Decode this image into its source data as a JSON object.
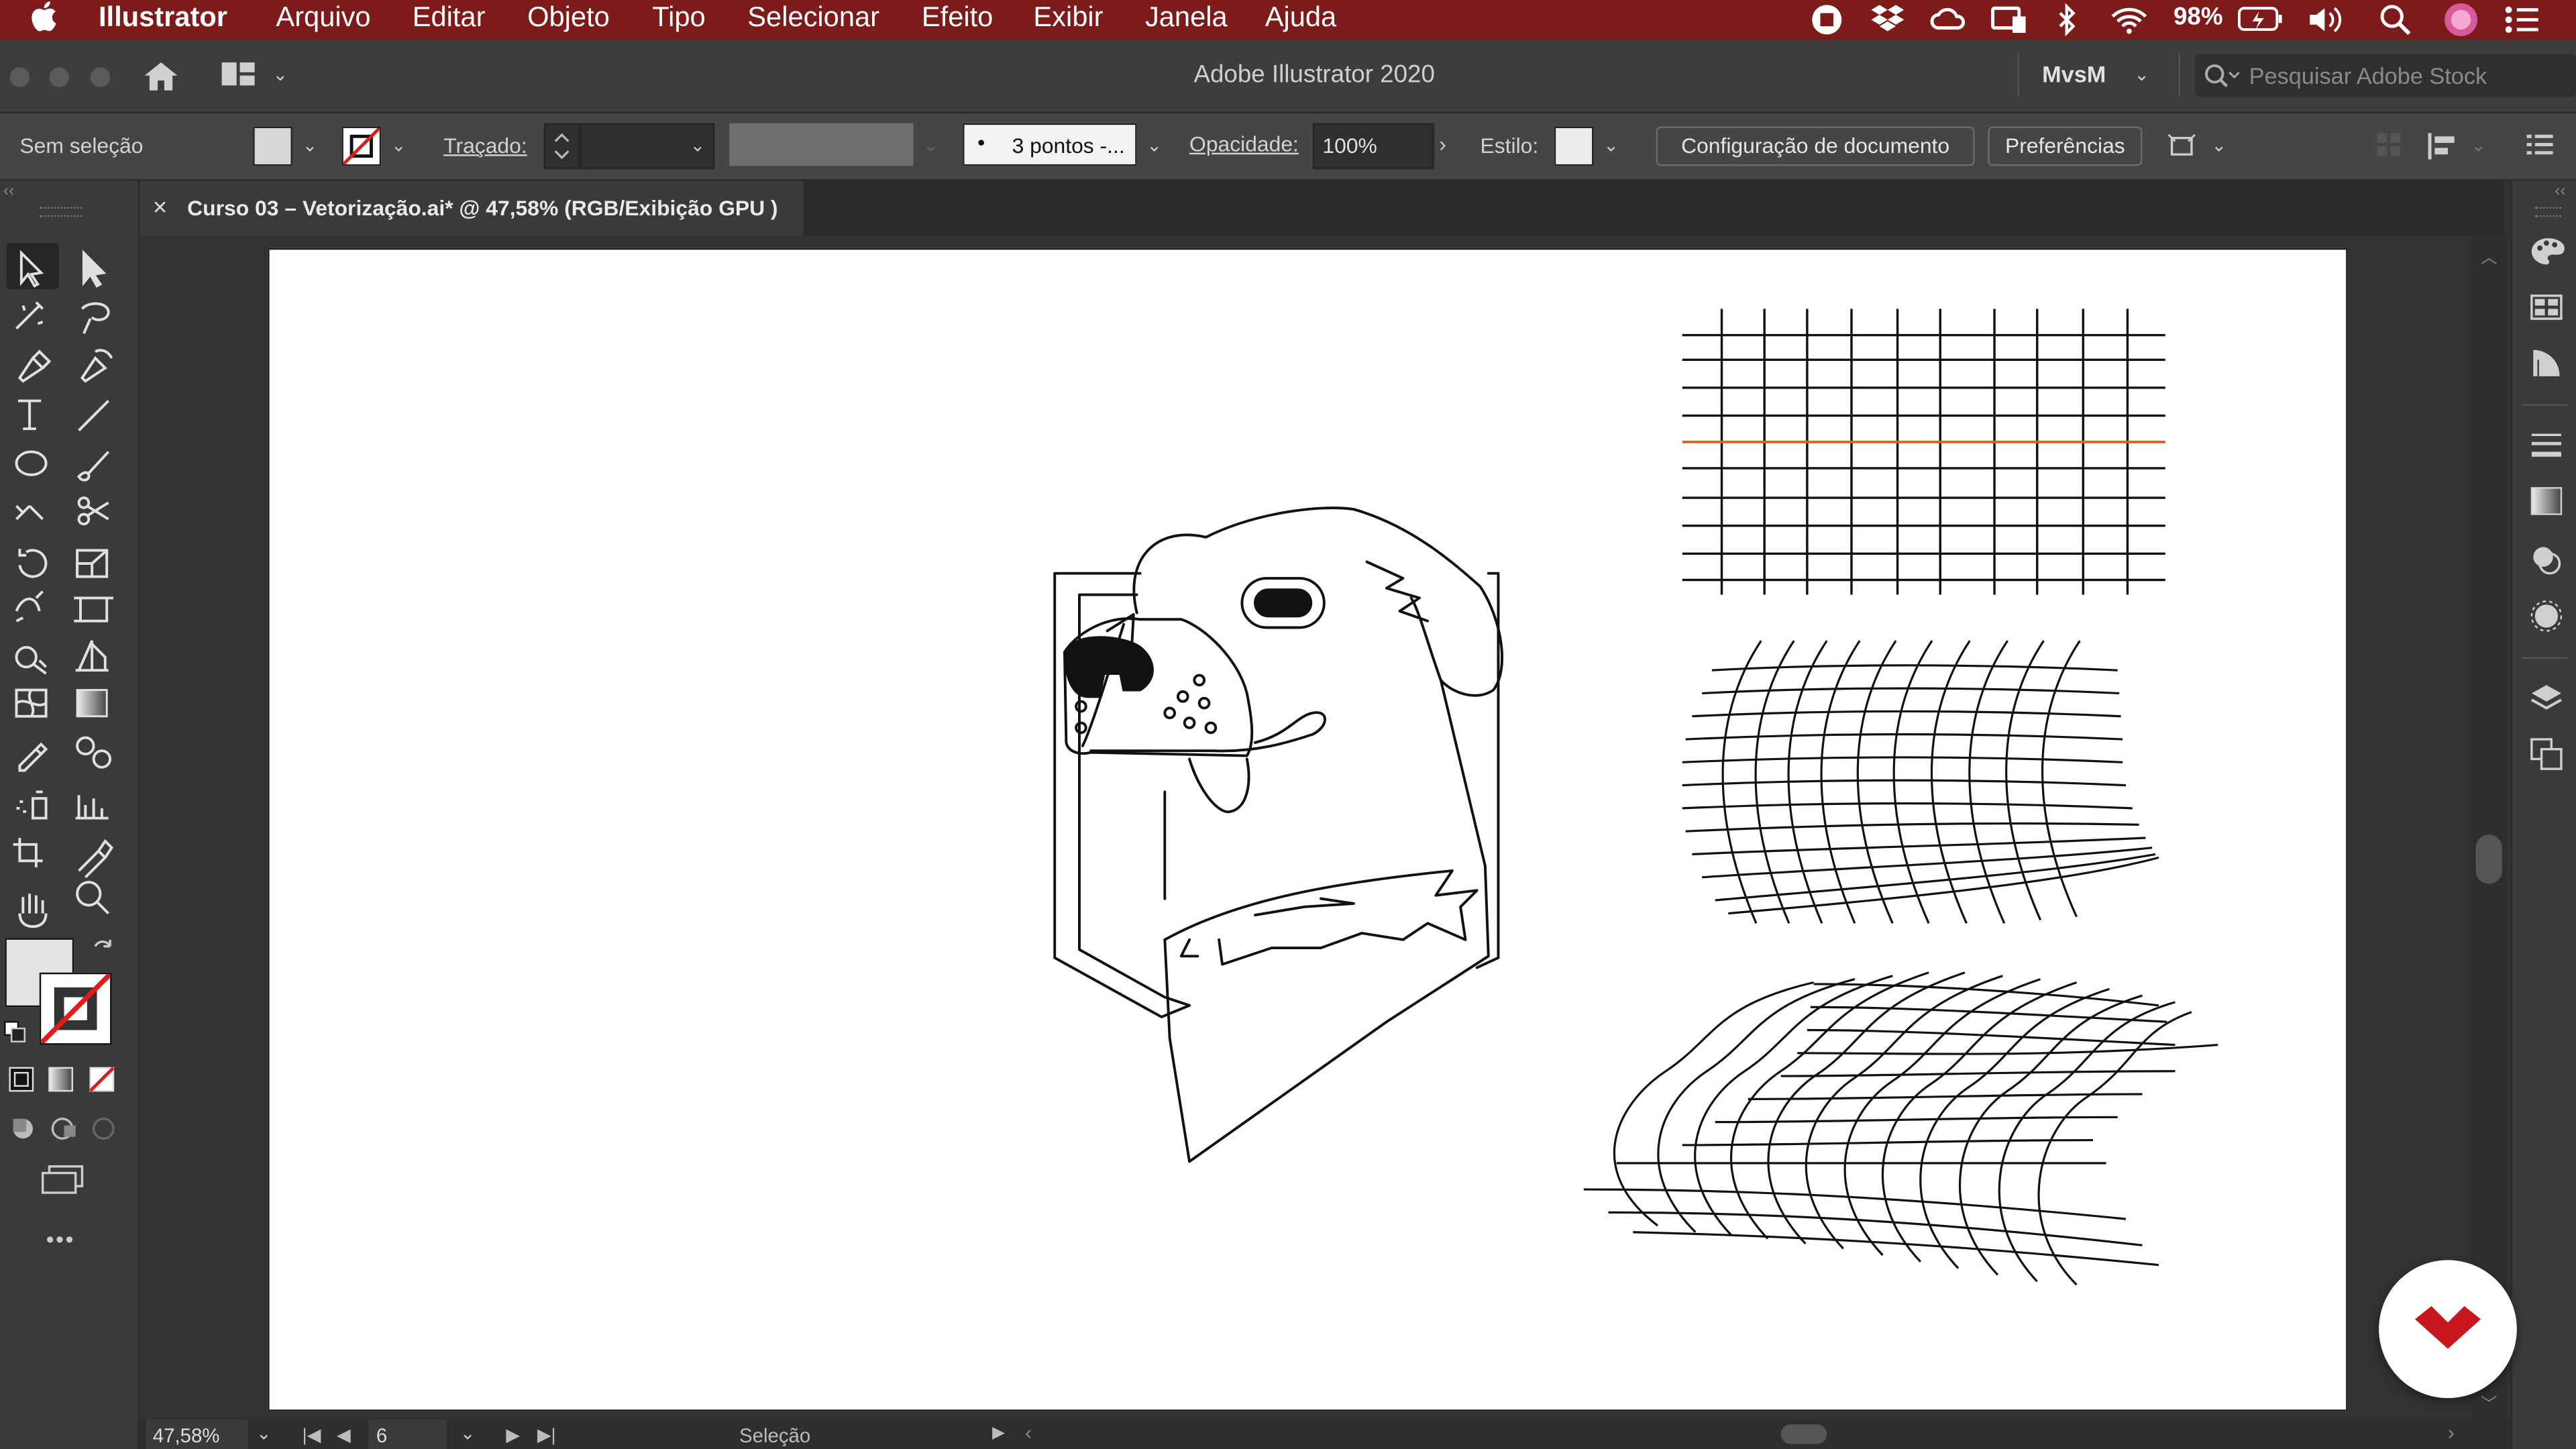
{
  "menubar": {
    "app_name": "Illustrator",
    "items": [
      "Arquivo",
      "Editar",
      "Objeto",
      "Tipo",
      "Selecionar",
      "Efeito",
      "Exibir",
      "Janela",
      "Ajuda"
    ],
    "battery": "98%",
    "color": "#7d1a1a"
  },
  "titlebar": {
    "title": "Adobe Illustrator 2020",
    "workspace": "MvsM",
    "search_placeholder": "Pesquisar Adobe Stock"
  },
  "control_bar": {
    "selection": "Sem seleção",
    "stroke_label": "Traçado:",
    "brush_value": "3 pontos -...",
    "opacity_label": "Opacidade:",
    "opacity_value": "100%",
    "style_label": "Estilo:",
    "doc_setup": "Configuração de documento",
    "preferences": "Preferências"
  },
  "document": {
    "tab_title": "Curso 03 – Vetorização.ai* @ 47,58% (RGB/Exibição GPU )",
    "close_glyph": "×"
  },
  "status": {
    "zoom": "47,58%",
    "artboard": "6",
    "mode": "Seleção"
  },
  "left_toolbar": {
    "more_glyph": "•••"
  },
  "accent": {
    "guide_line": "#d2691e",
    "brand": "#c8161d"
  }
}
